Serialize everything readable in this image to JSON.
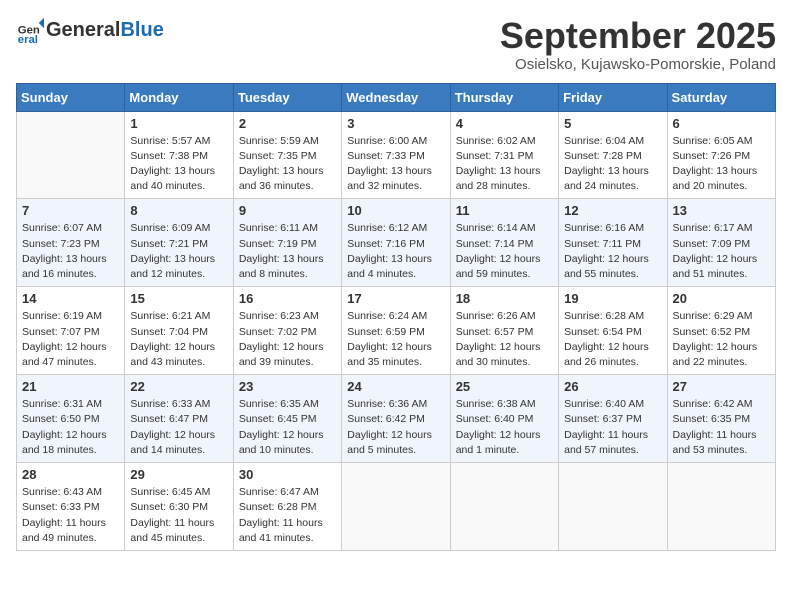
{
  "header": {
    "logo_line1": "General",
    "logo_line2": "Blue",
    "month_title": "September 2025",
    "location": "Osielsko, Kujawsko-Pomorskie, Poland"
  },
  "days_of_week": [
    "Sunday",
    "Monday",
    "Tuesday",
    "Wednesday",
    "Thursday",
    "Friday",
    "Saturday"
  ],
  "weeks": [
    [
      {
        "day": "",
        "info": ""
      },
      {
        "day": "1",
        "info": "Sunrise: 5:57 AM\nSunset: 7:38 PM\nDaylight: 13 hours\nand 40 minutes."
      },
      {
        "day": "2",
        "info": "Sunrise: 5:59 AM\nSunset: 7:35 PM\nDaylight: 13 hours\nand 36 minutes."
      },
      {
        "day": "3",
        "info": "Sunrise: 6:00 AM\nSunset: 7:33 PM\nDaylight: 13 hours\nand 32 minutes."
      },
      {
        "day": "4",
        "info": "Sunrise: 6:02 AM\nSunset: 7:31 PM\nDaylight: 13 hours\nand 28 minutes."
      },
      {
        "day": "5",
        "info": "Sunrise: 6:04 AM\nSunset: 7:28 PM\nDaylight: 13 hours\nand 24 minutes."
      },
      {
        "day": "6",
        "info": "Sunrise: 6:05 AM\nSunset: 7:26 PM\nDaylight: 13 hours\nand 20 minutes."
      }
    ],
    [
      {
        "day": "7",
        "info": "Sunrise: 6:07 AM\nSunset: 7:23 PM\nDaylight: 13 hours\nand 16 minutes."
      },
      {
        "day": "8",
        "info": "Sunrise: 6:09 AM\nSunset: 7:21 PM\nDaylight: 13 hours\nand 12 minutes."
      },
      {
        "day": "9",
        "info": "Sunrise: 6:11 AM\nSunset: 7:19 PM\nDaylight: 13 hours\nand 8 minutes."
      },
      {
        "day": "10",
        "info": "Sunrise: 6:12 AM\nSunset: 7:16 PM\nDaylight: 13 hours\nand 4 minutes."
      },
      {
        "day": "11",
        "info": "Sunrise: 6:14 AM\nSunset: 7:14 PM\nDaylight: 12 hours\nand 59 minutes."
      },
      {
        "day": "12",
        "info": "Sunrise: 6:16 AM\nSunset: 7:11 PM\nDaylight: 12 hours\nand 55 minutes."
      },
      {
        "day": "13",
        "info": "Sunrise: 6:17 AM\nSunset: 7:09 PM\nDaylight: 12 hours\nand 51 minutes."
      }
    ],
    [
      {
        "day": "14",
        "info": "Sunrise: 6:19 AM\nSunset: 7:07 PM\nDaylight: 12 hours\nand 47 minutes."
      },
      {
        "day": "15",
        "info": "Sunrise: 6:21 AM\nSunset: 7:04 PM\nDaylight: 12 hours\nand 43 minutes."
      },
      {
        "day": "16",
        "info": "Sunrise: 6:23 AM\nSunset: 7:02 PM\nDaylight: 12 hours\nand 39 minutes."
      },
      {
        "day": "17",
        "info": "Sunrise: 6:24 AM\nSunset: 6:59 PM\nDaylight: 12 hours\nand 35 minutes."
      },
      {
        "day": "18",
        "info": "Sunrise: 6:26 AM\nSunset: 6:57 PM\nDaylight: 12 hours\nand 30 minutes."
      },
      {
        "day": "19",
        "info": "Sunrise: 6:28 AM\nSunset: 6:54 PM\nDaylight: 12 hours\nand 26 minutes."
      },
      {
        "day": "20",
        "info": "Sunrise: 6:29 AM\nSunset: 6:52 PM\nDaylight: 12 hours\nand 22 minutes."
      }
    ],
    [
      {
        "day": "21",
        "info": "Sunrise: 6:31 AM\nSunset: 6:50 PM\nDaylight: 12 hours\nand 18 minutes."
      },
      {
        "day": "22",
        "info": "Sunrise: 6:33 AM\nSunset: 6:47 PM\nDaylight: 12 hours\nand 14 minutes."
      },
      {
        "day": "23",
        "info": "Sunrise: 6:35 AM\nSunset: 6:45 PM\nDaylight: 12 hours\nand 10 minutes."
      },
      {
        "day": "24",
        "info": "Sunrise: 6:36 AM\nSunset: 6:42 PM\nDaylight: 12 hours\nand 5 minutes."
      },
      {
        "day": "25",
        "info": "Sunrise: 6:38 AM\nSunset: 6:40 PM\nDaylight: 12 hours\nand 1 minute."
      },
      {
        "day": "26",
        "info": "Sunrise: 6:40 AM\nSunset: 6:37 PM\nDaylight: 11 hours\nand 57 minutes."
      },
      {
        "day": "27",
        "info": "Sunrise: 6:42 AM\nSunset: 6:35 PM\nDaylight: 11 hours\nand 53 minutes."
      }
    ],
    [
      {
        "day": "28",
        "info": "Sunrise: 6:43 AM\nSunset: 6:33 PM\nDaylight: 11 hours\nand 49 minutes."
      },
      {
        "day": "29",
        "info": "Sunrise: 6:45 AM\nSunset: 6:30 PM\nDaylight: 11 hours\nand 45 minutes."
      },
      {
        "day": "30",
        "info": "Sunrise: 6:47 AM\nSunset: 6:28 PM\nDaylight: 11 hours\nand 41 minutes."
      },
      {
        "day": "",
        "info": ""
      },
      {
        "day": "",
        "info": ""
      },
      {
        "day": "",
        "info": ""
      },
      {
        "day": "",
        "info": ""
      }
    ]
  ]
}
